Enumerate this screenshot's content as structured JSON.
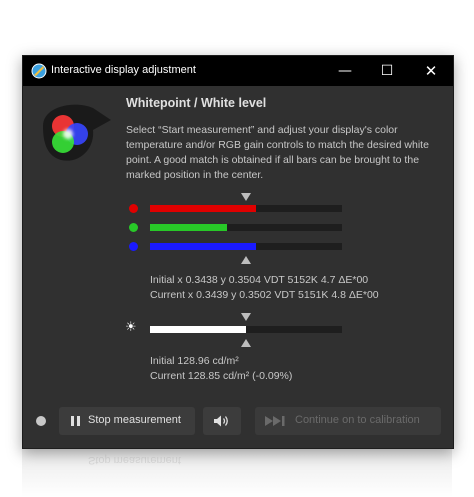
{
  "window": {
    "title": "Interactive display adjustment",
    "controls": {
      "minimize": "—",
      "maximize": "☐",
      "close": "✕"
    }
  },
  "content": {
    "heading": "Whitepoint / White level",
    "description": "Select “Start measurement” and adjust your display's color temperature and/or RGB gain controls to match the desired white point. A good match is obtained if all bars can be brought to the marked position in the center."
  },
  "rgb_bars": [
    {
      "channel": "red",
      "color": "#e00000",
      "level": 0.55
    },
    {
      "channel": "green",
      "color": "#28c828",
      "level": 0.4
    },
    {
      "channel": "blue",
      "color": "#1a1aff",
      "level": 0.55
    }
  ],
  "whitepoint_readout": {
    "initial": "Initial x 0.3438 y 0.3504 VDT 5152K 4.7 ΔE*00",
    "current": "Current x 0.3439 y 0.3502 VDT 5151K 4.8 ΔE*00"
  },
  "luminance_bar": {
    "color": "#ffffff",
    "level": 0.5
  },
  "luminance_readout": {
    "initial": "Initial 128.96 cd/m²",
    "current": "Current 128.85 cd/m² (-0.09%)"
  },
  "buttons": {
    "stop_measurement": "Stop measurement",
    "continue_calibration": "Continue on to calibration"
  },
  "icons": {
    "app": "display-calibration-icon",
    "sound": "speaker-icon",
    "brightness": "sun-icon",
    "continue": "skip-forward-icon"
  }
}
